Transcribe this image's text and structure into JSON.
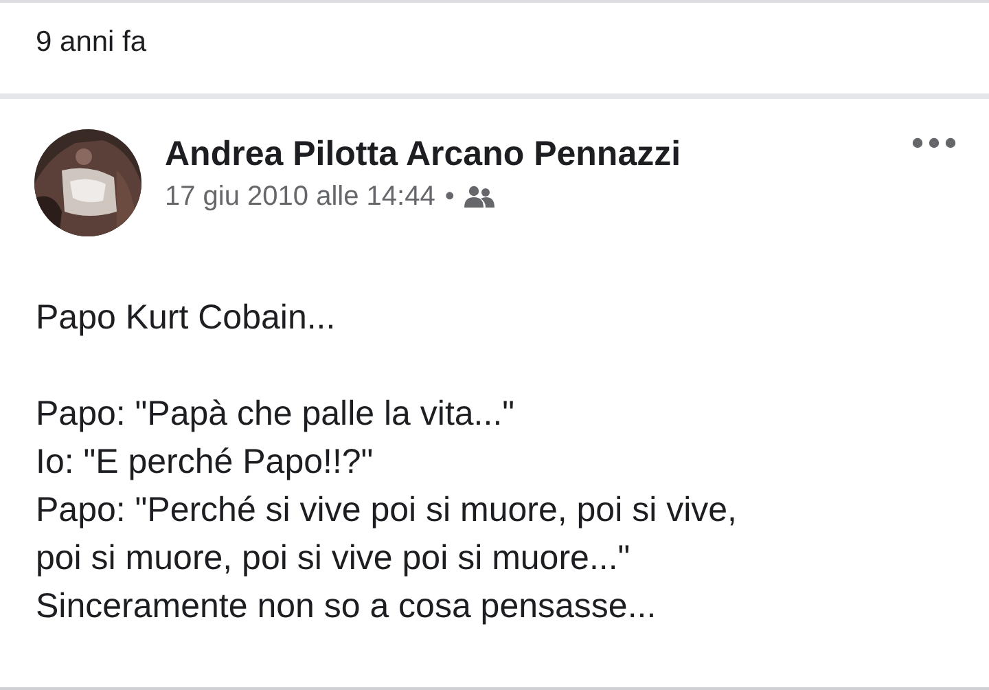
{
  "memory_header": {
    "label": "9 anni fa"
  },
  "post": {
    "author": "Andrea Pilotta Arcano Pennazzi",
    "avatar": {
      "kind": "picture"
    },
    "timestamp": "17 giu 2010 alle 14:44",
    "separator": "•",
    "paragraphs": [
      [
        "Papo Kurt Cobain..."
      ],
      [
        "Papo: \"Papà che palle la vita...\"",
        "Io: \"E perché Papo!!?\"",
        "Papo: \"Perché si vive poi si muore, poi si vive,",
        "poi si muore, poi si vive poi si muore...\"",
        "Sinceramente non so a cosa pensasse..."
      ]
    ]
  }
}
